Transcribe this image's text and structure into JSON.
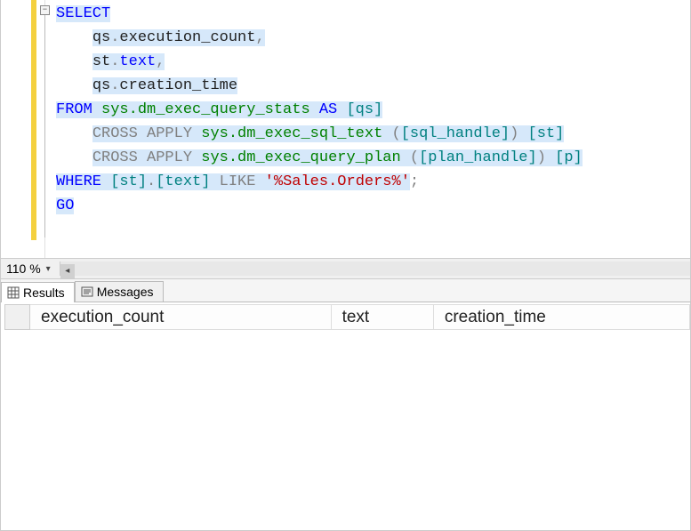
{
  "editor": {
    "lines": [
      [
        {
          "t": "SELECT",
          "c": "kw-blue",
          "hl": true
        }
      ],
      [
        {
          "t": "    ",
          "c": "plain"
        },
        {
          "t": "qs",
          "c": "plain",
          "hl": true
        },
        {
          "t": ".",
          "c": "punct",
          "hl": true
        },
        {
          "t": "execution_count",
          "c": "plain",
          "hl": true
        },
        {
          "t": ",",
          "c": "punct",
          "hl": true
        }
      ],
      [
        {
          "t": "    ",
          "c": "plain"
        },
        {
          "t": "st",
          "c": "plain",
          "hl": true
        },
        {
          "t": ".",
          "c": "punct",
          "hl": true
        },
        {
          "t": "text",
          "c": "kw-blue",
          "hl": true
        },
        {
          "t": ",",
          "c": "punct",
          "hl": true
        }
      ],
      [
        {
          "t": "    ",
          "c": "plain"
        },
        {
          "t": "qs",
          "c": "plain",
          "hl": true
        },
        {
          "t": ".",
          "c": "punct",
          "hl": true
        },
        {
          "t": "creation_time",
          "c": "plain",
          "hl": true
        }
      ],
      [
        {
          "t": "FROM",
          "c": "kw-blue",
          "hl": true
        },
        {
          "t": " ",
          "c": "plain",
          "hl": true
        },
        {
          "t": "sys.dm_exec_query_stats",
          "c": "kw-green",
          "hl": true
        },
        {
          "t": " ",
          "c": "plain",
          "hl": true
        },
        {
          "t": "AS",
          "c": "kw-blue",
          "hl": true
        },
        {
          "t": " ",
          "c": "plain",
          "hl": true
        },
        {
          "t": "[qs]",
          "c": "kw-teal",
          "hl": true
        }
      ],
      [
        {
          "t": "    ",
          "c": "plain"
        },
        {
          "t": "CROSS",
          "c": "kw-gray",
          "hl": true
        },
        {
          "t": " ",
          "c": "plain",
          "hl": true
        },
        {
          "t": "APPLY",
          "c": "kw-gray",
          "hl": true
        },
        {
          "t": " ",
          "c": "plain",
          "hl": true
        },
        {
          "t": "sys.dm_exec_sql_text",
          "c": "kw-green",
          "hl": true
        },
        {
          "t": " ",
          "c": "plain",
          "hl": true
        },
        {
          "t": "(",
          "c": "punct",
          "hl": true
        },
        {
          "t": "[sql_handle]",
          "c": "kw-teal",
          "hl": true
        },
        {
          "t": ")",
          "c": "punct",
          "hl": true
        },
        {
          "t": " ",
          "c": "plain",
          "hl": true
        },
        {
          "t": "[st]",
          "c": "kw-teal",
          "hl": true
        }
      ],
      [
        {
          "t": "    ",
          "c": "plain"
        },
        {
          "t": "CROSS",
          "c": "kw-gray",
          "hl": true
        },
        {
          "t": " ",
          "c": "plain",
          "hl": true
        },
        {
          "t": "APPLY",
          "c": "kw-gray",
          "hl": true
        },
        {
          "t": " ",
          "c": "plain",
          "hl": true
        },
        {
          "t": "sys.dm_exec_query_plan",
          "c": "kw-green",
          "hl": true
        },
        {
          "t": " ",
          "c": "plain",
          "hl": true
        },
        {
          "t": "(",
          "c": "punct",
          "hl": true
        },
        {
          "t": "[plan_handle]",
          "c": "kw-teal",
          "hl": true
        },
        {
          "t": ")",
          "c": "punct",
          "hl": true
        },
        {
          "t": " ",
          "c": "plain",
          "hl": true
        },
        {
          "t": "[p]",
          "c": "kw-teal",
          "hl": true
        }
      ],
      [
        {
          "t": "WHERE",
          "c": "kw-blue",
          "hl": true
        },
        {
          "t": " ",
          "c": "plain",
          "hl": true
        },
        {
          "t": "[st]",
          "c": "kw-teal",
          "hl": true
        },
        {
          "t": ".",
          "c": "punct",
          "hl": true
        },
        {
          "t": "[text]",
          "c": "kw-teal",
          "hl": true
        },
        {
          "t": " ",
          "c": "plain",
          "hl": true
        },
        {
          "t": "LIKE",
          "c": "kw-gray",
          "hl": true
        },
        {
          "t": " ",
          "c": "plain",
          "hl": true
        },
        {
          "t": "'%Sales.Orders%'",
          "c": "str-red",
          "hl": true
        },
        {
          "t": ";",
          "c": "punct"
        }
      ],
      [
        {
          "t": "GO",
          "c": "kw-blue",
          "hl": true
        }
      ]
    ],
    "collapse_symbol": "−"
  },
  "zoom": {
    "value": "110 %"
  },
  "tabs": {
    "results": "Results",
    "messages": "Messages"
  },
  "grid": {
    "columns": [
      "execution_count",
      "text",
      "creation_time"
    ]
  }
}
